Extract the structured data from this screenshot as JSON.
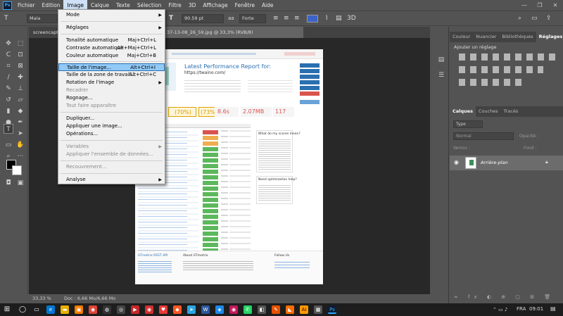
{
  "menubar": {
    "items": [
      "Fichier",
      "Edition",
      "Image",
      "Calque",
      "Texte",
      "Sélection",
      "Filtre",
      "3D",
      "Affichage",
      "Fenêtre",
      "Aide"
    ],
    "logo": "Ps"
  },
  "window_controls": [
    "—",
    "❐",
    "✕"
  ],
  "options": {
    "font_family": "Maia",
    "font_size": "90.59 pt",
    "antialias": "Forte",
    "text_color": "#3b63c9"
  },
  "tabs": {
    "first": "screencapt",
    "active": "37-13-08_26_59.jpg @ 33,3% (RVB/8)"
  },
  "image_menu": {
    "items": [
      {
        "label": "Mode",
        "shortcut": "",
        "submenu": true,
        "disabled": false
      },
      {
        "label": "Réglages",
        "shortcut": "",
        "submenu": true,
        "disabled": false
      },
      {
        "label": "Tonalité automatique",
        "shortcut": "Maj+Ctrl+L",
        "submenu": false,
        "disabled": false
      },
      {
        "label": "Contraste automatique",
        "shortcut": "Alt+Maj+Ctrl+L",
        "submenu": false,
        "disabled": false
      },
      {
        "label": "Couleur automatique",
        "shortcut": "Maj+Ctrl+B",
        "submenu": false,
        "disabled": false
      },
      {
        "label": "Taille de l'image...",
        "shortcut": "Alt+Ctrl+I",
        "submenu": false,
        "disabled": false,
        "highlighted": true
      },
      {
        "label": "Taille de la zone de travail...",
        "shortcut": "Alt+Ctrl+C",
        "submenu": false,
        "disabled": false
      },
      {
        "label": "Rotation de l'image",
        "shortcut": "",
        "submenu": true,
        "disabled": false
      },
      {
        "label": "Recadrer",
        "shortcut": "",
        "submenu": false,
        "disabled": true
      },
      {
        "label": "Rognage...",
        "shortcut": "",
        "submenu": false,
        "disabled": false
      },
      {
        "label": "Tout faire apparaître",
        "shortcut": "",
        "submenu": false,
        "disabled": true
      },
      {
        "label": "Dupliquer...",
        "shortcut": "",
        "submenu": false,
        "disabled": false
      },
      {
        "label": "Appliquer une image...",
        "shortcut": "",
        "submenu": false,
        "disabled": false
      },
      {
        "label": "Opérations...",
        "shortcut": "",
        "submenu": false,
        "disabled": false
      },
      {
        "label": "Variables",
        "shortcut": "",
        "submenu": true,
        "disabled": true
      },
      {
        "label": "Appliquer l'ensemble de données...",
        "shortcut": "",
        "submenu": false,
        "disabled": true
      },
      {
        "label": "Recouvrement...",
        "shortcut": "",
        "submenu": false,
        "disabled": true
      },
      {
        "label": "Analyse",
        "shortcut": "",
        "submenu": true,
        "disabled": false
      }
    ]
  },
  "status": {
    "zoom": "33,33 %",
    "doc": "Doc : 6,66 Mo/6,66 Mo"
  },
  "panels": {
    "top_tabs": [
      "Couleur",
      "Nuancier",
      "Bibliothèques",
      "Réglages"
    ],
    "adjust_label": "Ajouter un réglage",
    "layer_tabs": [
      "Calques",
      "Couches",
      "Tracés"
    ],
    "layer_kind": "Type",
    "blend_mode": "Normal",
    "opacity_label": "Opacité :",
    "lock_label": "Verrou :",
    "fill_label": "Fond :",
    "layer_name": "Arrière-plan"
  },
  "taskbar": {
    "lang": "FRA",
    "time": "09:01"
  },
  "webpage": {
    "title": "Latest Performance Report for:",
    "url": "https://twaino.com/",
    "grades": {
      "pagespeed": "(70%)",
      "yslow": "(73%)"
    },
    "timings": {
      "load": "8.6s",
      "size": "2.07MB",
      "requests": "117"
    },
    "box1": "What do my scores mean?",
    "box2": "Need optimization help?",
    "footer": [
      "GTmetrix REST API",
      "About GTmetrix",
      "Follow Us"
    ]
  }
}
